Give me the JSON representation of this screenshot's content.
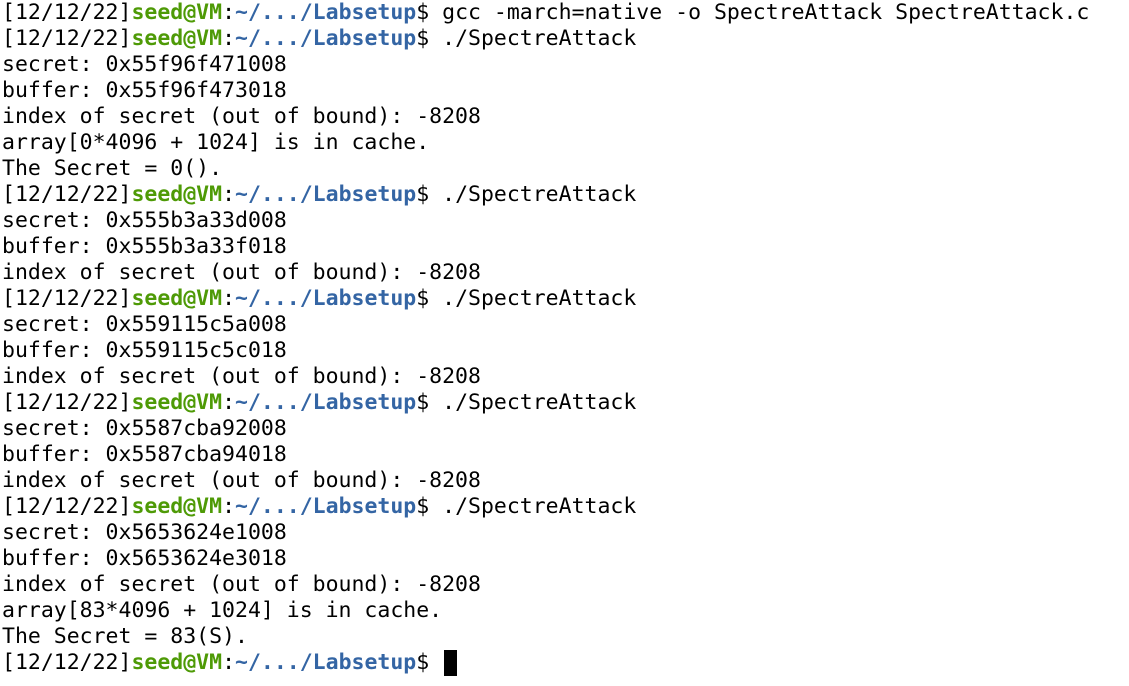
{
  "colors": {
    "user_host": "#4e9a06",
    "path": "#3465a4",
    "text": "#000000",
    "background": "#ffffff"
  },
  "prompt": {
    "date": "[12/12/22]",
    "user_host": "seed@VM",
    "colon": ":",
    "path": "~/.../Labsetup",
    "dollar": "$ "
  },
  "lines": [
    {
      "type": "prompt",
      "command": "gcc -march=native -o SpectreAttack SpectreAttack.c"
    },
    {
      "type": "prompt",
      "command": "./SpectreAttack"
    },
    {
      "type": "output",
      "text": "secret: 0x55f96f471008"
    },
    {
      "type": "output",
      "text": "buffer: 0x55f96f473018"
    },
    {
      "type": "output",
      "text": "index of secret (out of bound): -8208"
    },
    {
      "type": "output",
      "text": "array[0*4096 + 1024] is in cache."
    },
    {
      "type": "output",
      "text": "The Secret = 0()."
    },
    {
      "type": "prompt",
      "command": "./SpectreAttack"
    },
    {
      "type": "output",
      "text": "secret: 0x555b3a33d008"
    },
    {
      "type": "output",
      "text": "buffer: 0x555b3a33f018"
    },
    {
      "type": "output",
      "text": "index of secret (out of bound): -8208"
    },
    {
      "type": "prompt",
      "command": "./SpectreAttack"
    },
    {
      "type": "output",
      "text": "secret: 0x559115c5a008"
    },
    {
      "type": "output",
      "text": "buffer: 0x559115c5c018"
    },
    {
      "type": "output",
      "text": "index of secret (out of bound): -8208"
    },
    {
      "type": "prompt",
      "command": "./SpectreAttack"
    },
    {
      "type": "output",
      "text": "secret: 0x5587cba92008"
    },
    {
      "type": "output",
      "text": "buffer: 0x5587cba94018"
    },
    {
      "type": "output",
      "text": "index of secret (out of bound): -8208"
    },
    {
      "type": "prompt",
      "command": "./SpectreAttack"
    },
    {
      "type": "output",
      "text": "secret: 0x5653624e1008"
    },
    {
      "type": "output",
      "text": "buffer: 0x5653624e3018"
    },
    {
      "type": "output",
      "text": "index of secret (out of bound): -8208"
    },
    {
      "type": "output",
      "text": "array[83*4096 + 1024] is in cache."
    },
    {
      "type": "output",
      "text": "The Secret = 83(S)."
    },
    {
      "type": "prompt",
      "command": "",
      "cursor": true
    }
  ]
}
